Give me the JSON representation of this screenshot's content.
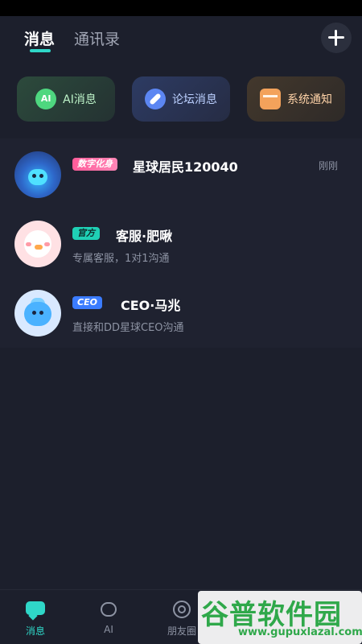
{
  "header": {
    "tabs": [
      {
        "label": "消息",
        "active": true
      },
      {
        "label": "通讯录",
        "active": false
      }
    ],
    "add_icon": "plus-icon"
  },
  "quick_actions": [
    {
      "label": "AI消息",
      "icon": "ai-chat-icon",
      "icon_text": "AI"
    },
    {
      "label": "论坛消息",
      "icon": "compass-icon"
    },
    {
      "label": "系统通知",
      "icon": "inbox-icon"
    }
  ],
  "conversations": [
    {
      "badge": "数字化身",
      "name": "星球居民120040",
      "preview": "",
      "time": "刚刚"
    },
    {
      "badge": "官方",
      "name": "客服·肥啾",
      "preview": "专属客服，1对1沟通",
      "time": ""
    },
    {
      "badge": "CEO",
      "name": "CEO·马兆",
      "preview": "直接和DD星球CEO沟通",
      "time": ""
    }
  ],
  "tabbar": {
    "items": [
      {
        "label": "消息",
        "icon": "chat-icon",
        "active": true
      },
      {
        "label": "AI",
        "icon": "heart-icon",
        "active": false
      },
      {
        "label": "朋友圈",
        "icon": "moments-icon",
        "active": false
      }
    ]
  },
  "watermark": {
    "title": "谷普软件园",
    "url": "www.gupuxlazal.com"
  },
  "colors": {
    "background": "#1c1f2c",
    "accent": "#2fd7c8",
    "badge_pink": "#ff5c9a",
    "badge_teal": "#1fd0b5",
    "badge_blue": "#3b7cff"
  }
}
